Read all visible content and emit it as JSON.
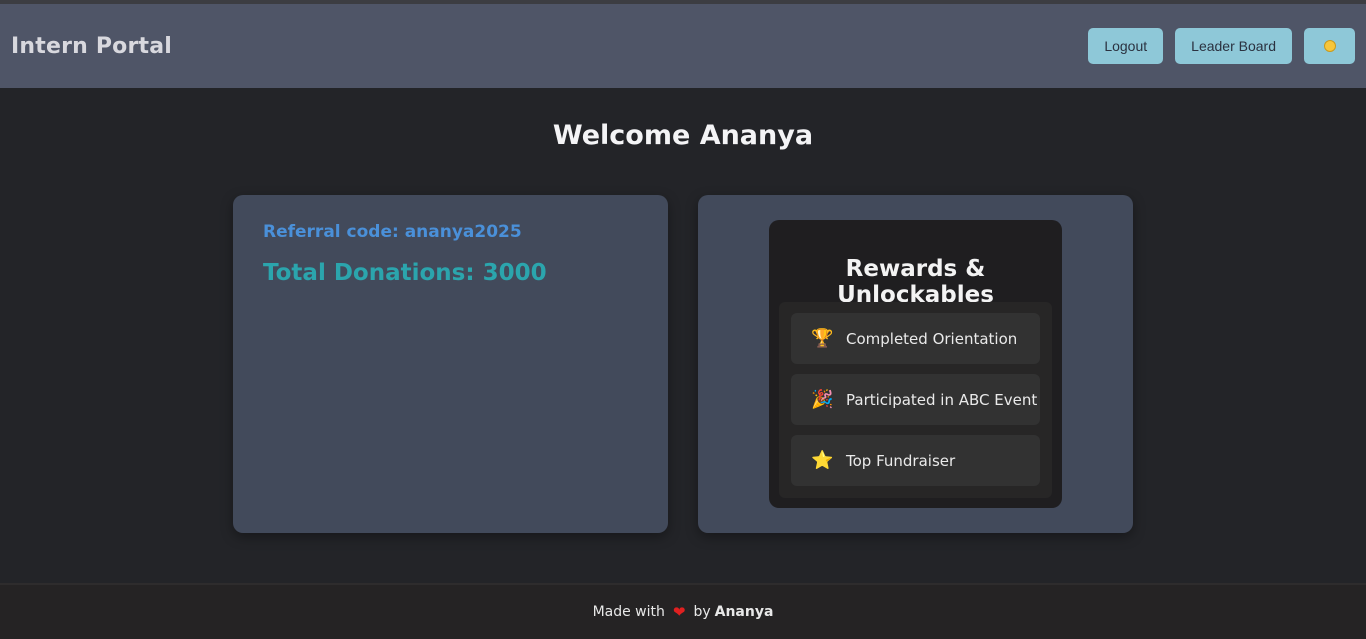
{
  "header": {
    "brand": "Intern Portal",
    "logout_label": "Logout",
    "leaderboard_label": "Leader Board",
    "theme_icon": "sun-icon"
  },
  "welcome": "Welcome Ananya",
  "stats": {
    "referral": "Referral code: ananya2025",
    "donations": "Total Donations: 3000"
  },
  "rewards": {
    "title": "Rewards & Unlockables",
    "items": [
      {
        "icon": "trophy-icon",
        "glyph": "🏆",
        "label": "Completed Orientation"
      },
      {
        "icon": "party-popper-icon",
        "glyph": "🎉",
        "label": "Participated in ABC Event"
      },
      {
        "icon": "star-icon",
        "glyph": "⭐",
        "label": "Top Fundraiser"
      }
    ]
  },
  "footer": {
    "made_with": "Made with",
    "heart_glyph": "❤",
    "by": "by",
    "author": "Ananya"
  },
  "colors": {
    "header_bg": "#4f5567",
    "button_bg": "#8ec8d8",
    "card_bg": "#424a5b",
    "referral": "#4a90d9",
    "donations": "#2ba5ad"
  }
}
